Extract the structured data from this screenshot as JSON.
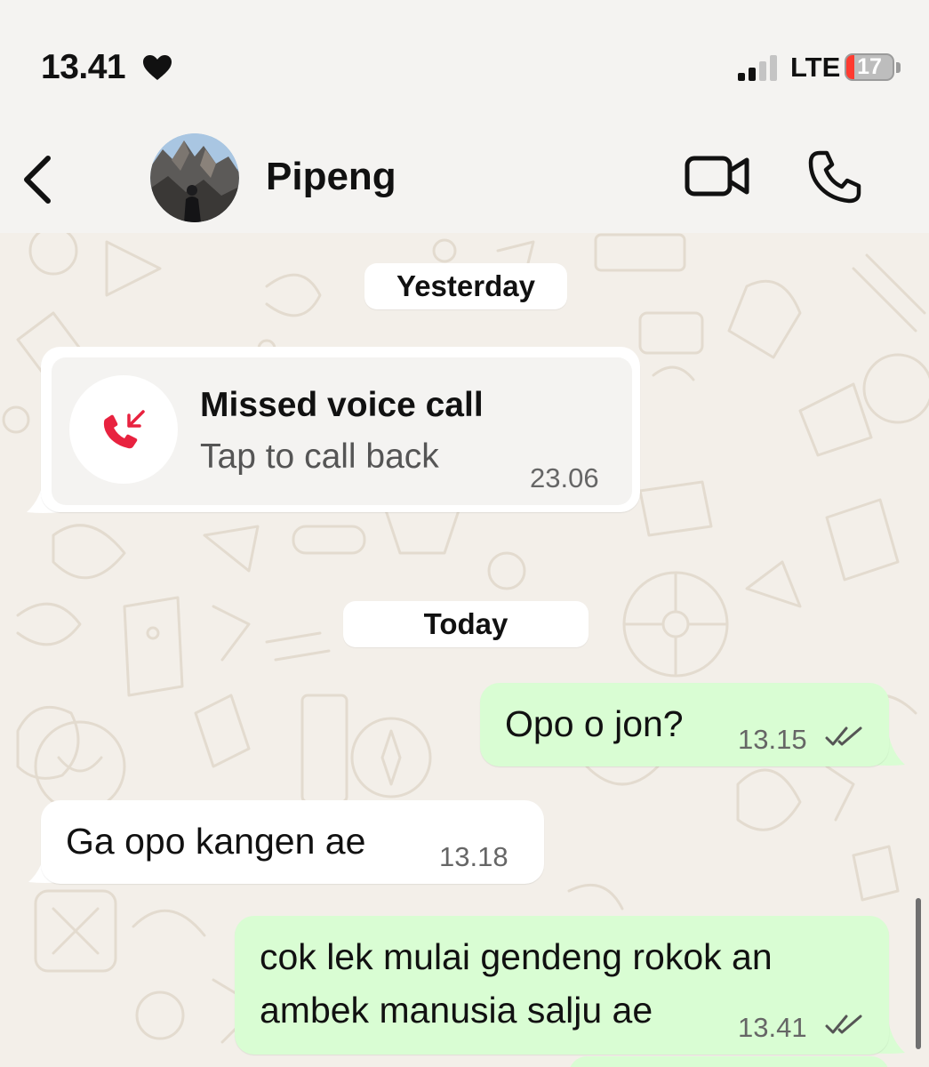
{
  "status_bar": {
    "time": "13.41",
    "network": "LTE",
    "battery_level": "17",
    "battery_fraction": 0.17
  },
  "header": {
    "back_icon": "chevron-left-icon",
    "contact_name": "Pipeng",
    "video_call_icon": "video-camera-icon",
    "voice_call_icon": "phone-icon"
  },
  "chat": {
    "date_yesterday": "Yesterday",
    "missed_call": {
      "title": "Missed voice call",
      "subtitle": "Tap to call back",
      "time": "23.06"
    },
    "date_today": "Today",
    "messages": [
      {
        "direction": "outgoing",
        "text": "Opo o jon?",
        "time": "13.15",
        "status": "read"
      },
      {
        "direction": "incoming",
        "text": "Ga opo kangen ae",
        "time": "13.18"
      },
      {
        "direction": "outgoing",
        "lines": [
          "cok lek mulai gendeng rokok an",
          "ambek manusia salju ae"
        ],
        "time": "13.41",
        "status": "read"
      }
    ]
  },
  "colors": {
    "outgoing_bubble": "#d9fdd3",
    "incoming_bubble": "#ffffff",
    "missed_call_red": "#e8223f",
    "chat_background": "#f3efe9"
  }
}
